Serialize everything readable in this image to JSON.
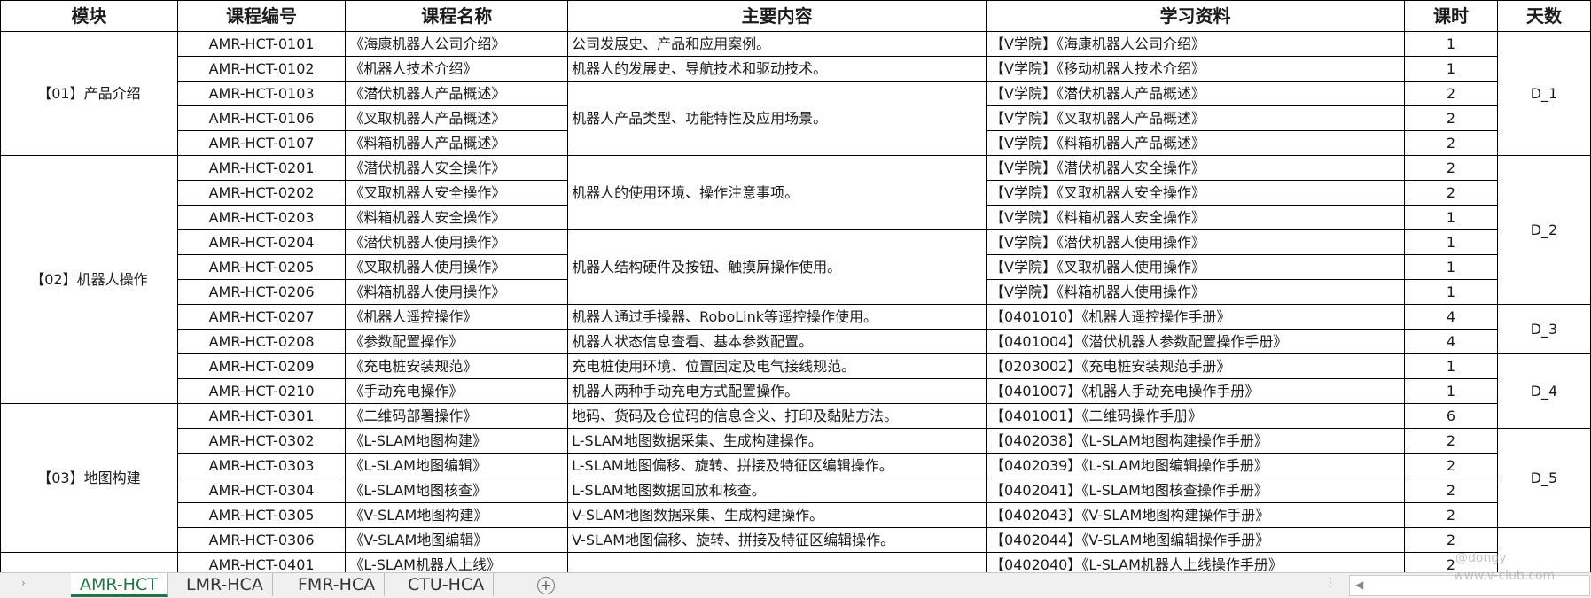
{
  "columns": [
    "模块",
    "课程编号",
    "课程名称",
    "主要内容",
    "学习资料",
    "课时",
    "天数"
  ],
  "modules": {
    "m01": "【01】产品介绍",
    "m02": "【02】机器人操作",
    "m03": "【03】地图构建"
  },
  "days": {
    "d1": "D_1",
    "d2": "D_2",
    "d3": "D_3",
    "d4": "D_4",
    "d5": "D_5"
  },
  "rows": [
    {
      "id": "AMR-HCT-0101",
      "name": "《海康机器人公司介绍》",
      "content": "公司发展史、产品和应用案例。",
      "tag": "【V学院】",
      "doc": "《海康机器人公司介绍》",
      "hours": "1"
    },
    {
      "id": "AMR-HCT-0102",
      "name": "《机器人技术介绍》",
      "content": "机器人的发展史、导航技术和驱动技术。",
      "tag": "【V学院】",
      "doc": "《移动机器人技术介绍》",
      "hours": "1"
    },
    {
      "id": "AMR-HCT-0103",
      "name": "《潜伏机器人产品概述》",
      "content": "机器人产品类型、功能特性及应用场景。",
      "tag": "【V学院】",
      "doc": "《潜伏机器人产品概述》",
      "hours": "2"
    },
    {
      "id": "AMR-HCT-0106",
      "name": "《叉取机器人产品概述》",
      "content": "",
      "tag": "【V学院】",
      "doc": "《叉取机器人产品概述》",
      "hours": "2"
    },
    {
      "id": "AMR-HCT-0107",
      "name": "《料箱机器人产品概述》",
      "content": "",
      "tag": "【V学院】",
      "doc": "《料箱机器人产品概述》",
      "hours": "2"
    },
    {
      "id": "AMR-HCT-0201",
      "name": "《潜伏机器人安全操作》",
      "content": "机器人的使用环境、操作注意事项。",
      "tag": "【V学院】",
      "doc": "《潜伏机器人安全操作》",
      "hours": "2"
    },
    {
      "id": "AMR-HCT-0202",
      "name": "《叉取机器人安全操作》",
      "content": "",
      "tag": "【V学院】",
      "doc": "《叉取机器人安全操作》",
      "hours": "2"
    },
    {
      "id": "AMR-HCT-0203",
      "name": "《料箱机器人安全操作》",
      "content": "",
      "tag": "【V学院】",
      "doc": "《料箱机器人安全操作》",
      "hours": "1"
    },
    {
      "id": "AMR-HCT-0204",
      "name": "《潜伏机器人使用操作》",
      "content": "机器人结构硬件及按钮、触摸屏操作使用。",
      "tag": "【V学院】",
      "doc": "《潜伏机器人使用操作》",
      "hours": "1"
    },
    {
      "id": "AMR-HCT-0205",
      "name": "《叉取机器人使用操作》",
      "content": "",
      "tag": "【V学院】",
      "doc": "《叉取机器人使用操作》",
      "hours": "1"
    },
    {
      "id": "AMR-HCT-0206",
      "name": "《料箱机器人使用操作》",
      "content": "",
      "tag": "【V学院】",
      "doc": "《料箱机器人使用操作》",
      "hours": "1"
    },
    {
      "id": "AMR-HCT-0207",
      "name": "《机器人遥控操作》",
      "content": "机器人通过手操器、RoboLink等遥控操作使用。",
      "tag": "【0401010】",
      "doc": "《机器人遥控操作手册》",
      "hours": "4"
    },
    {
      "id": "AMR-HCT-0208",
      "name": "《参数配置操作》",
      "content": "机器人状态信息查看、基本参数配置。",
      "tag": "【0401004】",
      "doc": "《潜伏机器人参数配置操作手册》",
      "hours": "4"
    },
    {
      "id": "AMR-HCT-0209",
      "name": "《充电桩安装规范》",
      "content": "充电桩使用环境、位置固定及电气接线规范。",
      "tag": "【0203002】",
      "doc": "《充电桩安装规范手册》",
      "hours": "1"
    },
    {
      "id": "AMR-HCT-0210",
      "name": "《手动充电操作》",
      "content": "机器人两种手动充电方式配置操作。",
      "tag": "【0401007】",
      "doc": "《机器人手动充电操作手册》",
      "hours": "1"
    },
    {
      "id": "AMR-HCT-0301",
      "name": "《二维码部署操作》",
      "content": "地码、货码及仓位码的信息含义、打印及黏贴方法。",
      "tag": "【0401001】",
      "doc": "《二维码操作手册》",
      "hours": "6"
    },
    {
      "id": "AMR-HCT-0302",
      "name": "《L-SLAM地图构建》",
      "content": "L-SLAM地图数据采集、生成构建操作。",
      "tag": "【0402038】",
      "doc": "《L-SLAM地图构建操作手册》",
      "hours": "2"
    },
    {
      "id": "AMR-HCT-0303",
      "name": "《L-SLAM地图编辑》",
      "content": "L-SLAM地图偏移、旋转、拼接及特征区编辑操作。",
      "tag": "【0402039】",
      "doc": "《L-SLAM地图编辑操作手册》",
      "hours": "2"
    },
    {
      "id": "AMR-HCT-0304",
      "name": "《L-SLAM地图核查》",
      "content": "L-SLAM地图数据回放和核查。",
      "tag": "【0402041】",
      "doc": "《L-SLAM地图核查操作手册》",
      "hours": "2"
    },
    {
      "id": "AMR-HCT-0305",
      "name": "《V-SLAM地图构建》",
      "content": "V-SLAM地图数据采集、生成构建操作。",
      "tag": "【0402043】",
      "doc": "《V-SLAM地图构建操作手册》",
      "hours": "2"
    },
    {
      "id": "AMR-HCT-0306",
      "name": "《V-SLAM地图编辑》",
      "content": "V-SLAM地图偏移、旋转、拼接及特征区编辑操作。",
      "tag": "【0402044】",
      "doc": "《V-SLAM地图编辑操作手册》",
      "hours": "2"
    },
    {
      "id": "AMR-HCT-0401",
      "name": "《L-SLAM机器人上线》",
      "content": "",
      "tag": "【0402040】",
      "doc": "《L-SLAM机器人上线操作手册》",
      "hours": "2"
    }
  ],
  "tabs": [
    "AMR-HCT",
    "LMR-HCA",
    "FMR-HCA",
    "CTU-HCA"
  ],
  "add_sheet": "+",
  "watermark": [
    "@dongy",
    "www.v-club.com"
  ],
  "accent_color": "#217346",
  "link_color": "#2e6fba"
}
